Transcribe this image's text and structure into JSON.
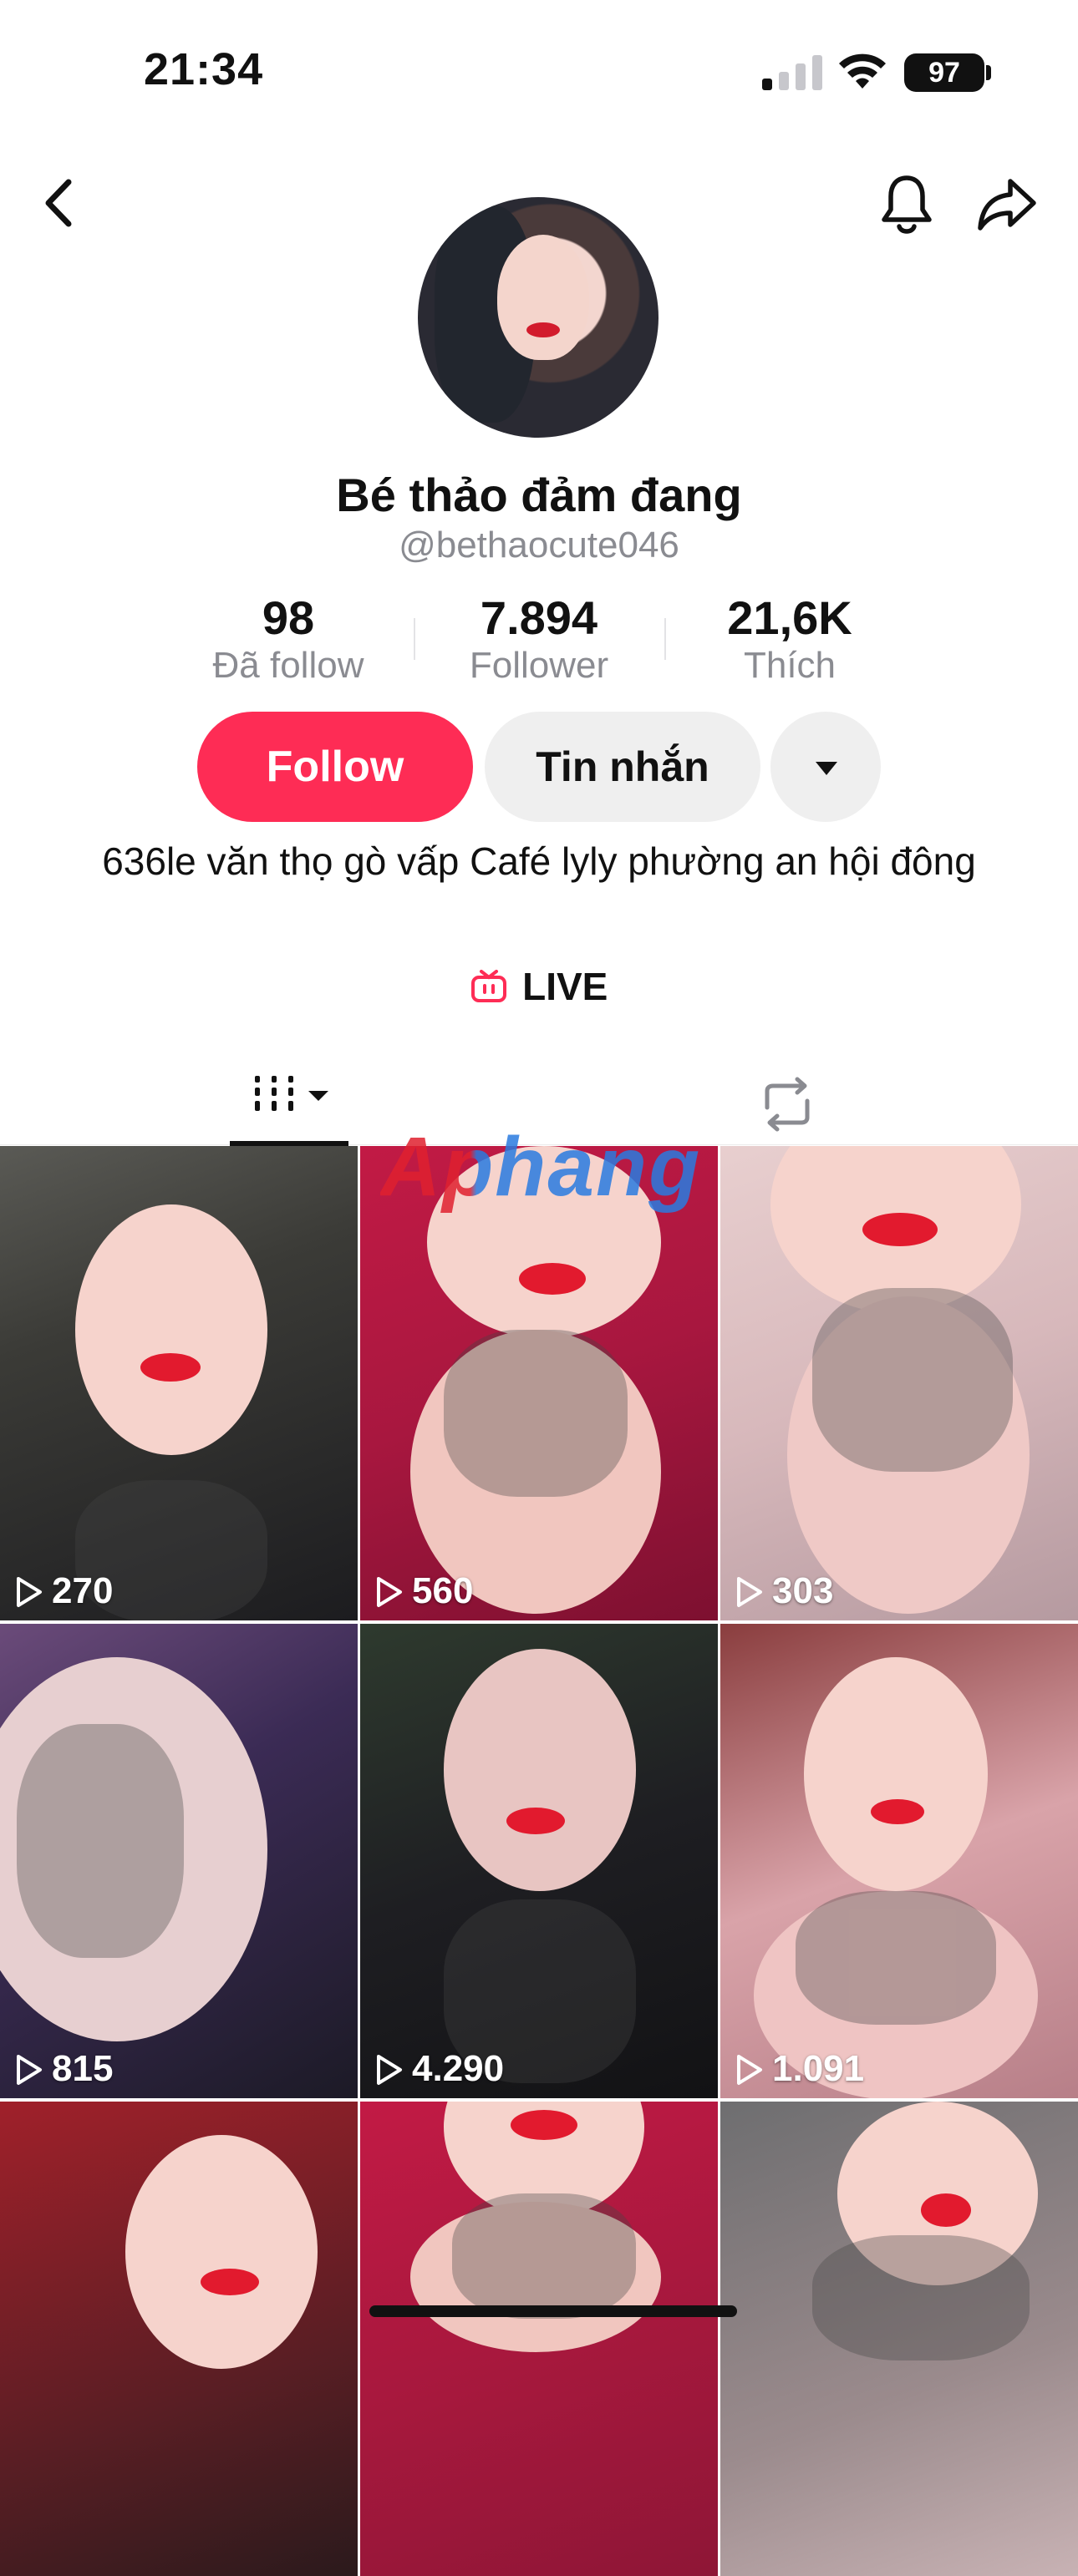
{
  "status_bar": {
    "time": "21:34",
    "battery": "97"
  },
  "profile": {
    "display_name": "Bé thảo đảm đang",
    "username": "@bethaocute046",
    "stats": [
      {
        "value": "98",
        "label": "Đã follow"
      },
      {
        "value": "7.894",
        "label": "Follower"
      },
      {
        "value": "21,6K",
        "label": "Thích"
      }
    ],
    "follow_label": "Follow",
    "message_label": "Tin nhắn",
    "bio": "636le văn thọ gò vấp Café lyly phường an hội đông",
    "live_label": "LIVE"
  },
  "watermark": "Aphang",
  "videos": [
    {
      "views": "270"
    },
    {
      "views": "560"
    },
    {
      "views": "303"
    },
    {
      "views": "815"
    },
    {
      "views": "4.290"
    },
    {
      "views": "1.091"
    },
    {
      "views": ""
    },
    {
      "views": ""
    },
    {
      "views": ""
    }
  ],
  "colors": {
    "accent": "#fe2c55",
    "secondary_button": "#efefef",
    "muted_text": "#8a8b91"
  }
}
